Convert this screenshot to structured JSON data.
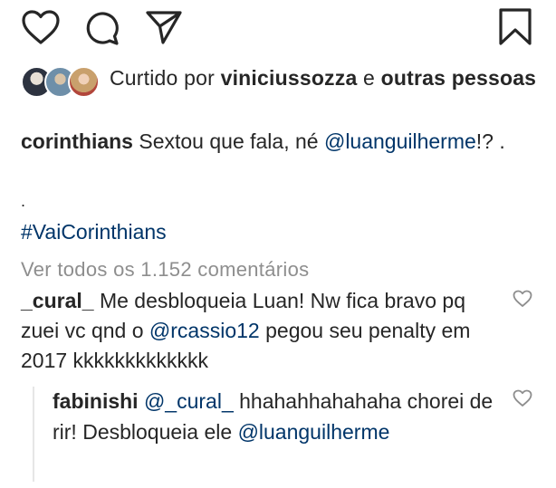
{
  "actions": {
    "icons": [
      "heart-icon",
      "comment-icon",
      "share-icon",
      "bookmark-icon"
    ]
  },
  "likes": {
    "prefix": "Curtido por ",
    "user": "viniciussozza",
    "conjunction": " e ",
    "others": "outras pessoas"
  },
  "caption": {
    "username": "corinthians",
    "text_before": " Sextou que fala, né ",
    "mention": "@luanguilherme",
    "text_after": "!? .",
    "dot": ".",
    "hashtag": "#VaiCorinthians"
  },
  "view_all": "Ver todos os 1.152 comentários",
  "comment": {
    "username": "_cural_",
    "text_before": " Me desbloqueia Luan! Nw fica bravo pq zuei vc qnd o ",
    "mention": "@rcassio12",
    "text_after": "  pegou seu penalty em 2017 kkkkkkkkkkkkk"
  },
  "reply": {
    "username": "fabinishi",
    "mention1": "@_cural_",
    "text": " hhahahhahahaha chorei de rir! Desbloqueia ele ",
    "mention2": "@luanguilherme"
  },
  "colors": {
    "text": "#262626",
    "link": "#003569",
    "muted": "#8e8e8e"
  }
}
